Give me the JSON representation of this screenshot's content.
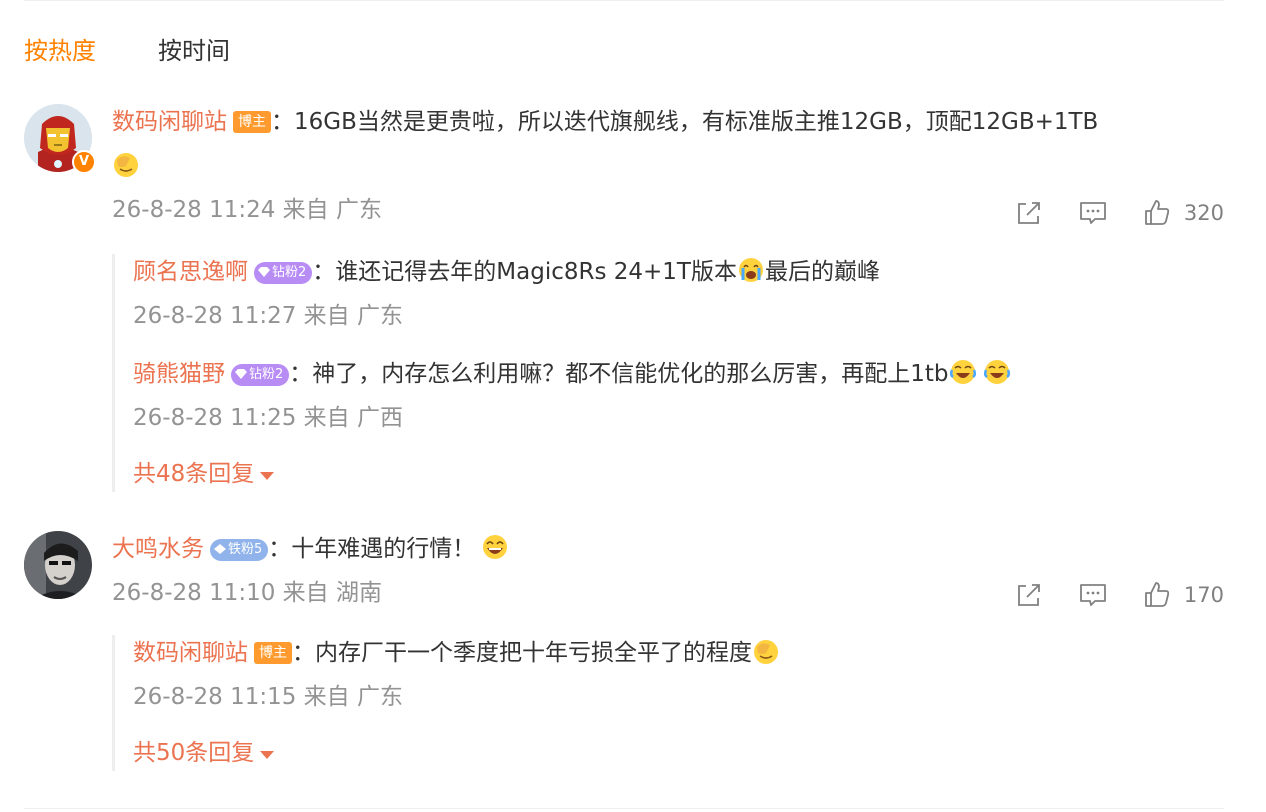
{
  "sort_tabs": [
    {
      "label": "按热度",
      "active": true
    },
    {
      "label": "按时间",
      "active": false
    }
  ],
  "comments": [
    {
      "user": "数码闲聊站",
      "badge": "博主",
      "separator": "：",
      "text_line1": "16GB当然是更贵啦，所以迭代旗舰线，有标准版主推12GB，顶配12GB+1TB",
      "text_line2_emoji": "emoji-facepalm",
      "meta": "26-8-28 11:24 来自 广东",
      "verified_badge": "V",
      "like_count": "320",
      "replies": [
        {
          "user": "顾名思逸啊",
          "badge": "钻粉2",
          "separator": "：",
          "text_before": "谁还记得去年的Magic8Rs 24+1T版本",
          "emoji": "emoji-crying",
          "text_after": "最后的巅峰",
          "meta": "26-8-28 11:27 来自 广东"
        },
        {
          "user": "骑熊猫野",
          "badge": "钻粉2",
          "separator": "：",
          "text_before": "神了，内存怎么利用嘛？都不信能优化的那么厉害，再配上1tb",
          "meta": "26-8-28 11:25 来自 广西"
        }
      ],
      "more_replies": "共48条回复"
    },
    {
      "user": "大鸣水务",
      "badge": "铁粉5",
      "separator": "：",
      "text_before": "十年难遇的行情！",
      "meta": "26-8-28 11:10 来自 湖南",
      "like_count": "170",
      "replies": [
        {
          "user": "数码闲聊站",
          "badge": "博主",
          "separator": "：",
          "text_before": "内存厂干一个季度把十年亏损全平了的程度",
          "meta": "26-8-28 11:15 来自 广东"
        }
      ],
      "more_replies": "共50条回复"
    }
  ],
  "icons": {
    "share": "share-icon",
    "comment": "comment-icon",
    "like": "like-icon"
  },
  "colors": {
    "accent": "#ff8200",
    "username": "#eb7350",
    "meta": "#939393"
  }
}
